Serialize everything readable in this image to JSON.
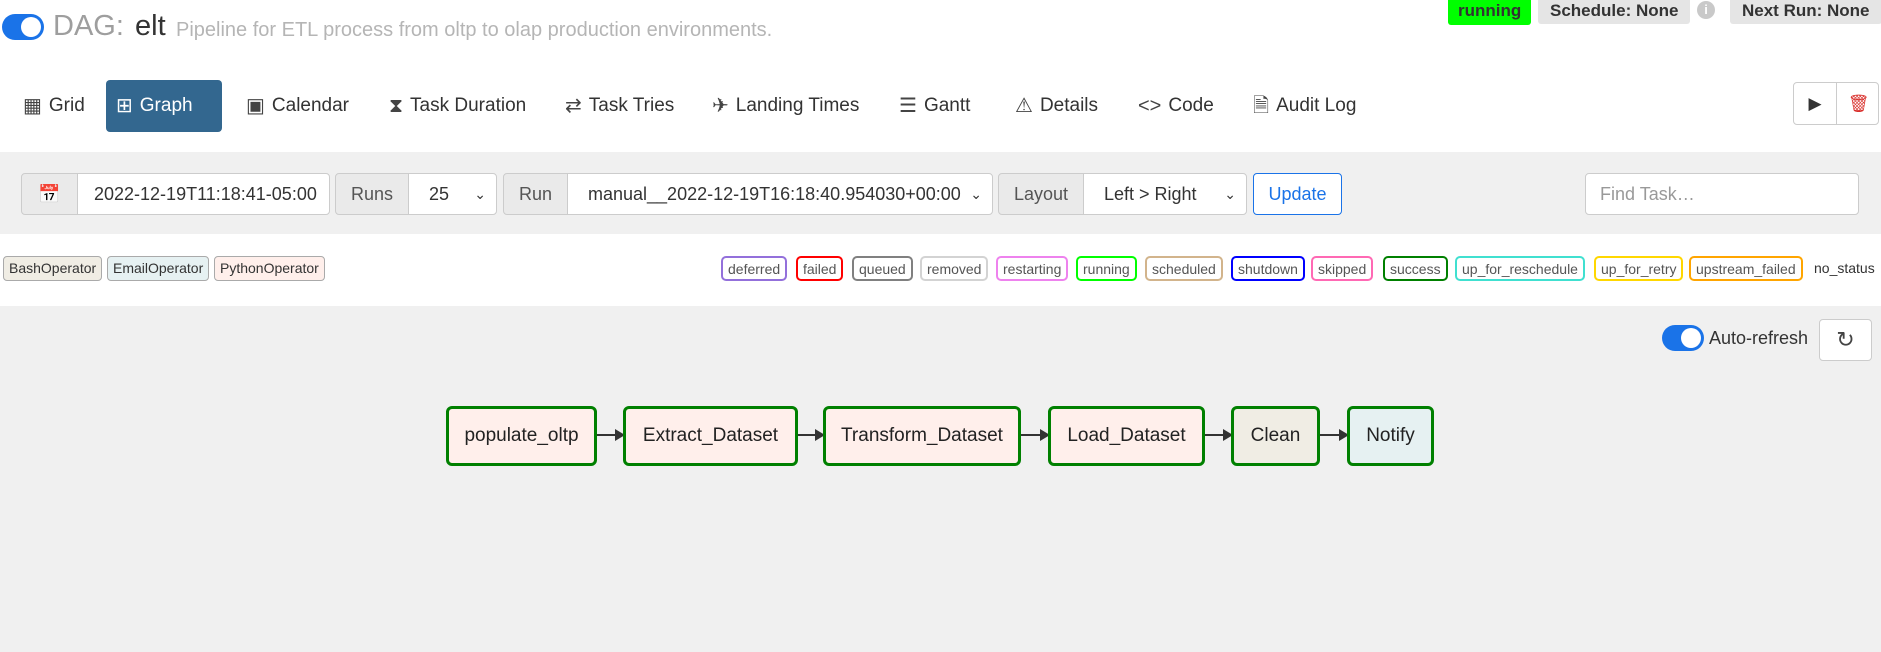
{
  "header": {
    "prefix": "DAG:",
    "dag_id": "elt",
    "description": "Pipeline for ETL process from oltp to olap production environments.",
    "state_badge": "running",
    "schedule": "Schedule: None",
    "next_run": "Next Run: None",
    "info_glyph": "i"
  },
  "nav": {
    "tabs": [
      {
        "label": "Grid",
        "icon": "grid-icon",
        "glyph": "▦"
      },
      {
        "label": "Graph",
        "icon": "graph-icon",
        "glyph": "⊞"
      },
      {
        "label": "Calendar",
        "icon": "calendar-icon",
        "glyph": "▣"
      },
      {
        "label": "Task Duration",
        "icon": "hourglass-icon",
        "glyph": "⧗"
      },
      {
        "label": "Task Tries",
        "icon": "repeat-icon",
        "glyph": "⇄"
      },
      {
        "label": "Landing Times",
        "icon": "plane-landing-icon",
        "glyph": "✈"
      },
      {
        "label": "Gantt",
        "icon": "gantt-icon",
        "glyph": "☰"
      },
      {
        "label": "Details",
        "icon": "warning-triangle-icon",
        "glyph": "⚠"
      },
      {
        "label": "Code",
        "icon": "code-icon",
        "glyph": "<>"
      },
      {
        "label": "Audit Log",
        "icon": "file-search-icon",
        "glyph": "🗎"
      }
    ],
    "active": "Graph",
    "actions": {
      "run_glyph": "▶",
      "delete_glyph": "🗑"
    }
  },
  "filters": {
    "calendar_glyph": "📅",
    "base_date": "2022-12-19T11:18:41-05:00",
    "runs_label": "Runs",
    "runs_value": "25",
    "run_label": "Run",
    "run_value": "manual__2022-12-19T16:18:40.954030+00:00",
    "layout_label": "Layout",
    "layout_value": "Left > Right",
    "update_label": "Update",
    "find_placeholder": "Find Task…",
    "caret_glyph": "⌄"
  },
  "legend": {
    "operators": [
      {
        "label": "BashOperator",
        "color": "#f0ede4"
      },
      {
        "label": "EmailOperator",
        "color": "#e6f1f2"
      },
      {
        "label": "PythonOperator",
        "color": "#ffefeb"
      }
    ],
    "states": [
      {
        "label": "deferred",
        "color": "#9370db"
      },
      {
        "label": "failed",
        "color": "#ff0000"
      },
      {
        "label": "queued",
        "color": "#808080"
      },
      {
        "label": "removed",
        "color": "#d3d3d3"
      },
      {
        "label": "restarting",
        "color": "#ee82ee"
      },
      {
        "label": "running",
        "color": "#00ff00"
      },
      {
        "label": "scheduled",
        "color": "#d2b48c"
      },
      {
        "label": "shutdown",
        "color": "#0000ff"
      },
      {
        "label": "skipped",
        "color": "#ff69b4"
      },
      {
        "label": "success",
        "color": "#008000"
      },
      {
        "label": "up_for_reschedule",
        "color": "#40e0d0"
      },
      {
        "label": "up_for_retry",
        "color": "#ffd700"
      },
      {
        "label": "upstream_failed",
        "color": "#ffa500"
      }
    ],
    "no_status": "no_status"
  },
  "graph": {
    "auto_refresh_label": "Auto-refresh",
    "refresh_glyph": "↻",
    "nodes": [
      {
        "label": "populate_oltp",
        "operator": "PythonOperator",
        "fill": "#ffefeb",
        "status": "success"
      },
      {
        "label": "Extract_Dataset",
        "operator": "PythonOperator",
        "fill": "#ffefeb",
        "status": "success"
      },
      {
        "label": "Transform_Dataset",
        "operator": "PythonOperator",
        "fill": "#ffefeb",
        "status": "success"
      },
      {
        "label": "Load_Dataset",
        "operator": "PythonOperator",
        "fill": "#ffefeb",
        "status": "success"
      },
      {
        "label": "Clean",
        "operator": "BashOperator",
        "fill": "#f0ede4",
        "status": "success"
      },
      {
        "label": "Notify",
        "operator": "EmailOperator",
        "fill": "#e6f1f2",
        "status": "success"
      }
    ]
  }
}
